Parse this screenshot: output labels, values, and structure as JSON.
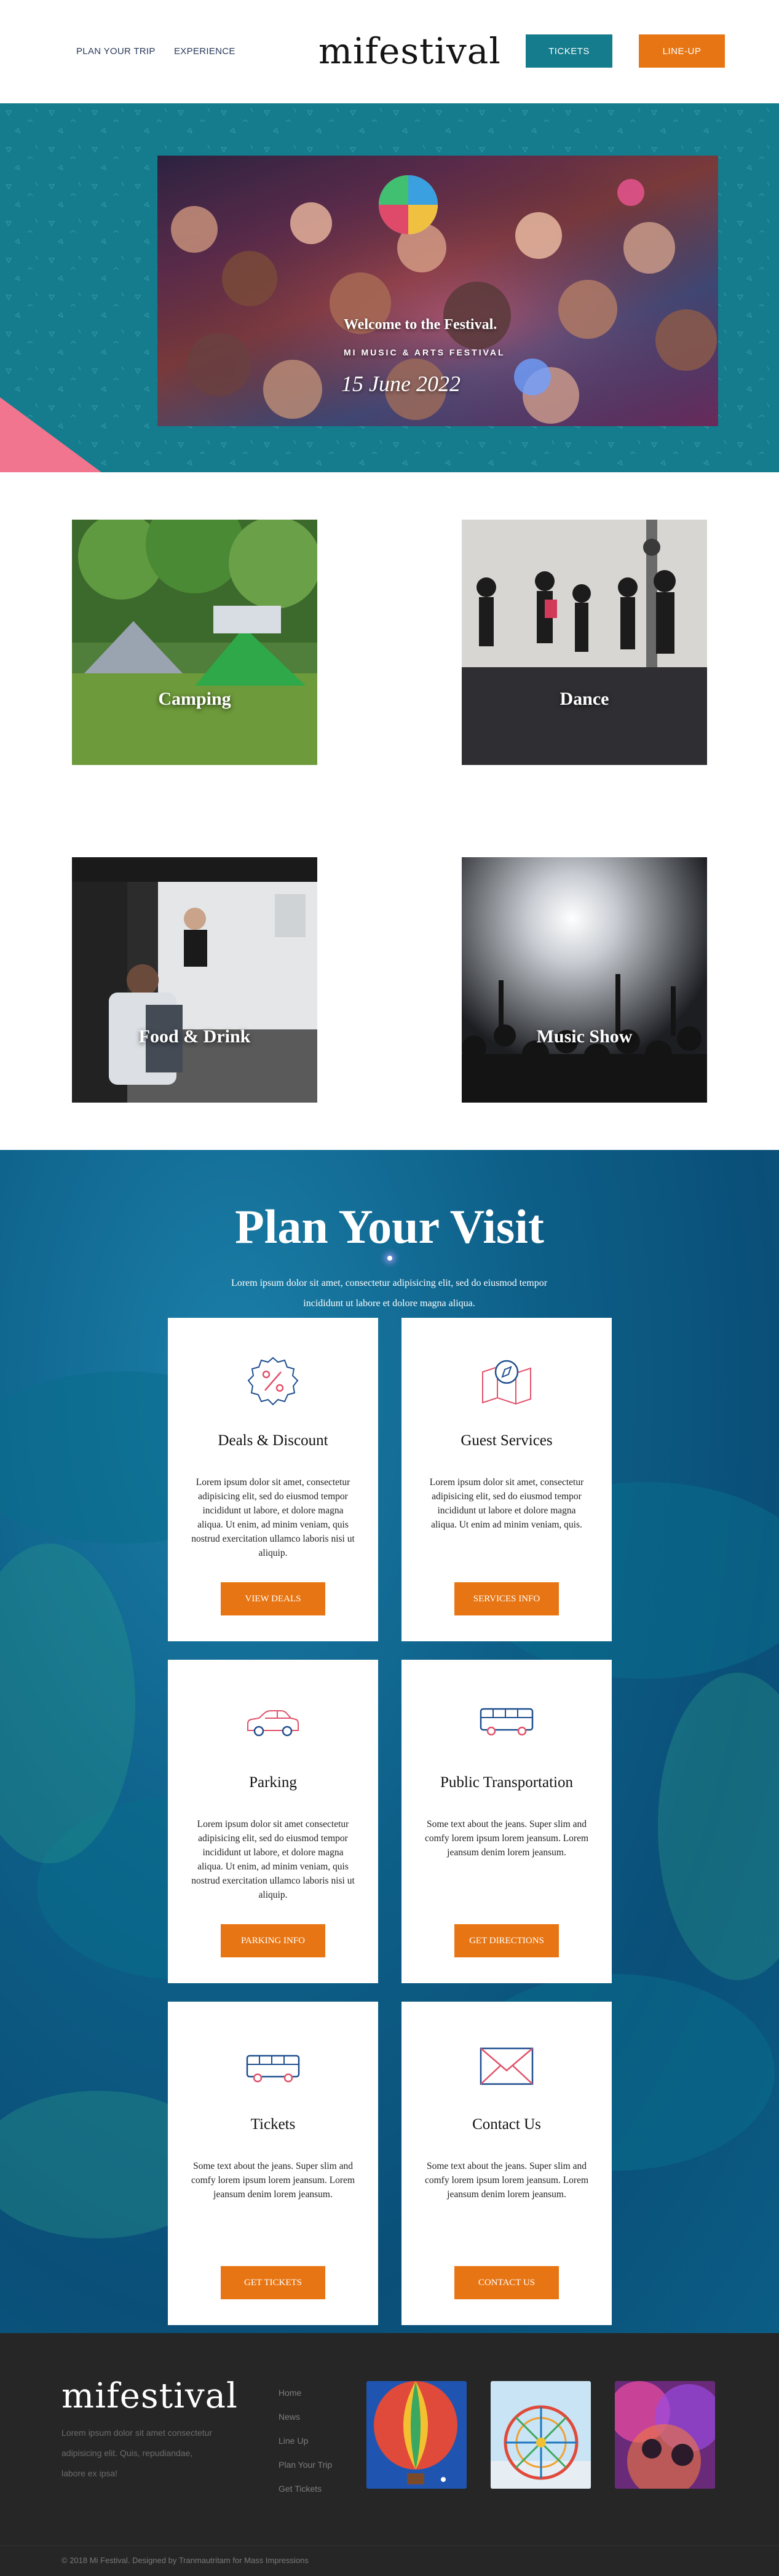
{
  "header": {
    "nav": [
      "PLAN YOUR TRIP",
      "EXPERIENCE"
    ],
    "logo": "mifestival",
    "tickets_label": "TICKETS",
    "lineup_label": "LINE-UP",
    "tickets_color": "#147c8c",
    "lineup_color": "#e87513"
  },
  "hero": {
    "title": "Welcome to the Festival.",
    "subtitle": "MI MUSIC & ARTS FESTIVAL",
    "date": "15 June 2022",
    "bg_color": "#147c8c",
    "accent_pink": "#f2758f"
  },
  "categories": [
    {
      "label": "Camping"
    },
    {
      "label": "Dance"
    },
    {
      "label": "Food & Drink"
    },
    {
      "label": "Music Show"
    }
  ],
  "plan": {
    "title": "Plan Your Visit",
    "intro": "Lorem ipsum dolor sit amet, consectetur adipisicing elit, sed do eiusmod tempor incididunt ut labore et dolore magna aliqua.",
    "cards": [
      {
        "icon": "discount-badge-icon",
        "title": "Deals & Discount",
        "text": "Lorem ipsum dolor sit amet, consectetur adipisicing elit, sed do eiusmod tempor incididunt ut labore, et dolore magna aliqua. Ut enim, ad minim veniam, quis nostrud exercitation ullamco laboris nisi ut aliquip.",
        "button": "VIEW DEALS"
      },
      {
        "icon": "map-compass-icon",
        "title": "Guest Services",
        "text": "Lorem ipsum dolor sit amet, consectetur adipisicing elit, sed do eiusmod tempor incididunt ut labore et dolore magna aliqua. Ut enim ad minim veniam, quis.",
        "button": "SERVICES INFO"
      },
      {
        "icon": "car-icon",
        "title": "Parking",
        "text": "Lorem ipsum dolor sit amet consectetur adipisicing elit, sed do eiusmod tempor incididunt ut labore, et dolore magna aliqua. Ut enim, ad minim veniam, quis nostrud exercitation ullamco laboris nisi ut aliquip.",
        "button": "PARKING INFO"
      },
      {
        "icon": "bus-icon",
        "title": "Public Transportation",
        "text": "Some text about the jeans. Super slim and comfy lorem ipsum lorem jeansum. Lorem jeansum denim lorem jeansum.",
        "button": "GET DIRECTIONS"
      },
      {
        "icon": "ticket-bus-icon",
        "title": "Tickets",
        "text": "Some text about the jeans. Super slim and comfy lorem ipsum lorem jeansum. Lorem jeansum denim lorem jeansum.",
        "button": "GET TICKETS"
      },
      {
        "icon": "envelope-icon",
        "title": "Contact Us",
        "text": "Some text about the jeans. Super slim and comfy lorem ipsum lorem jeansum. Lorem jeansum denim lorem jeansum.",
        "button": "CONTACT US"
      }
    ],
    "button_color": "#e87513"
  },
  "footer": {
    "logo": "mifestival",
    "description": "Lorem ipsum dolor sit amet consectetur adipisicing elit. Quis, repudiandae, labore ex ipsa!",
    "links": [
      "Home",
      "News",
      "Line Up",
      "Plan Your Trip",
      "Get Tickets"
    ],
    "copyright": "© 2018 Mi Festival. Designed by Tranmautritam for Mass Impressions"
  }
}
